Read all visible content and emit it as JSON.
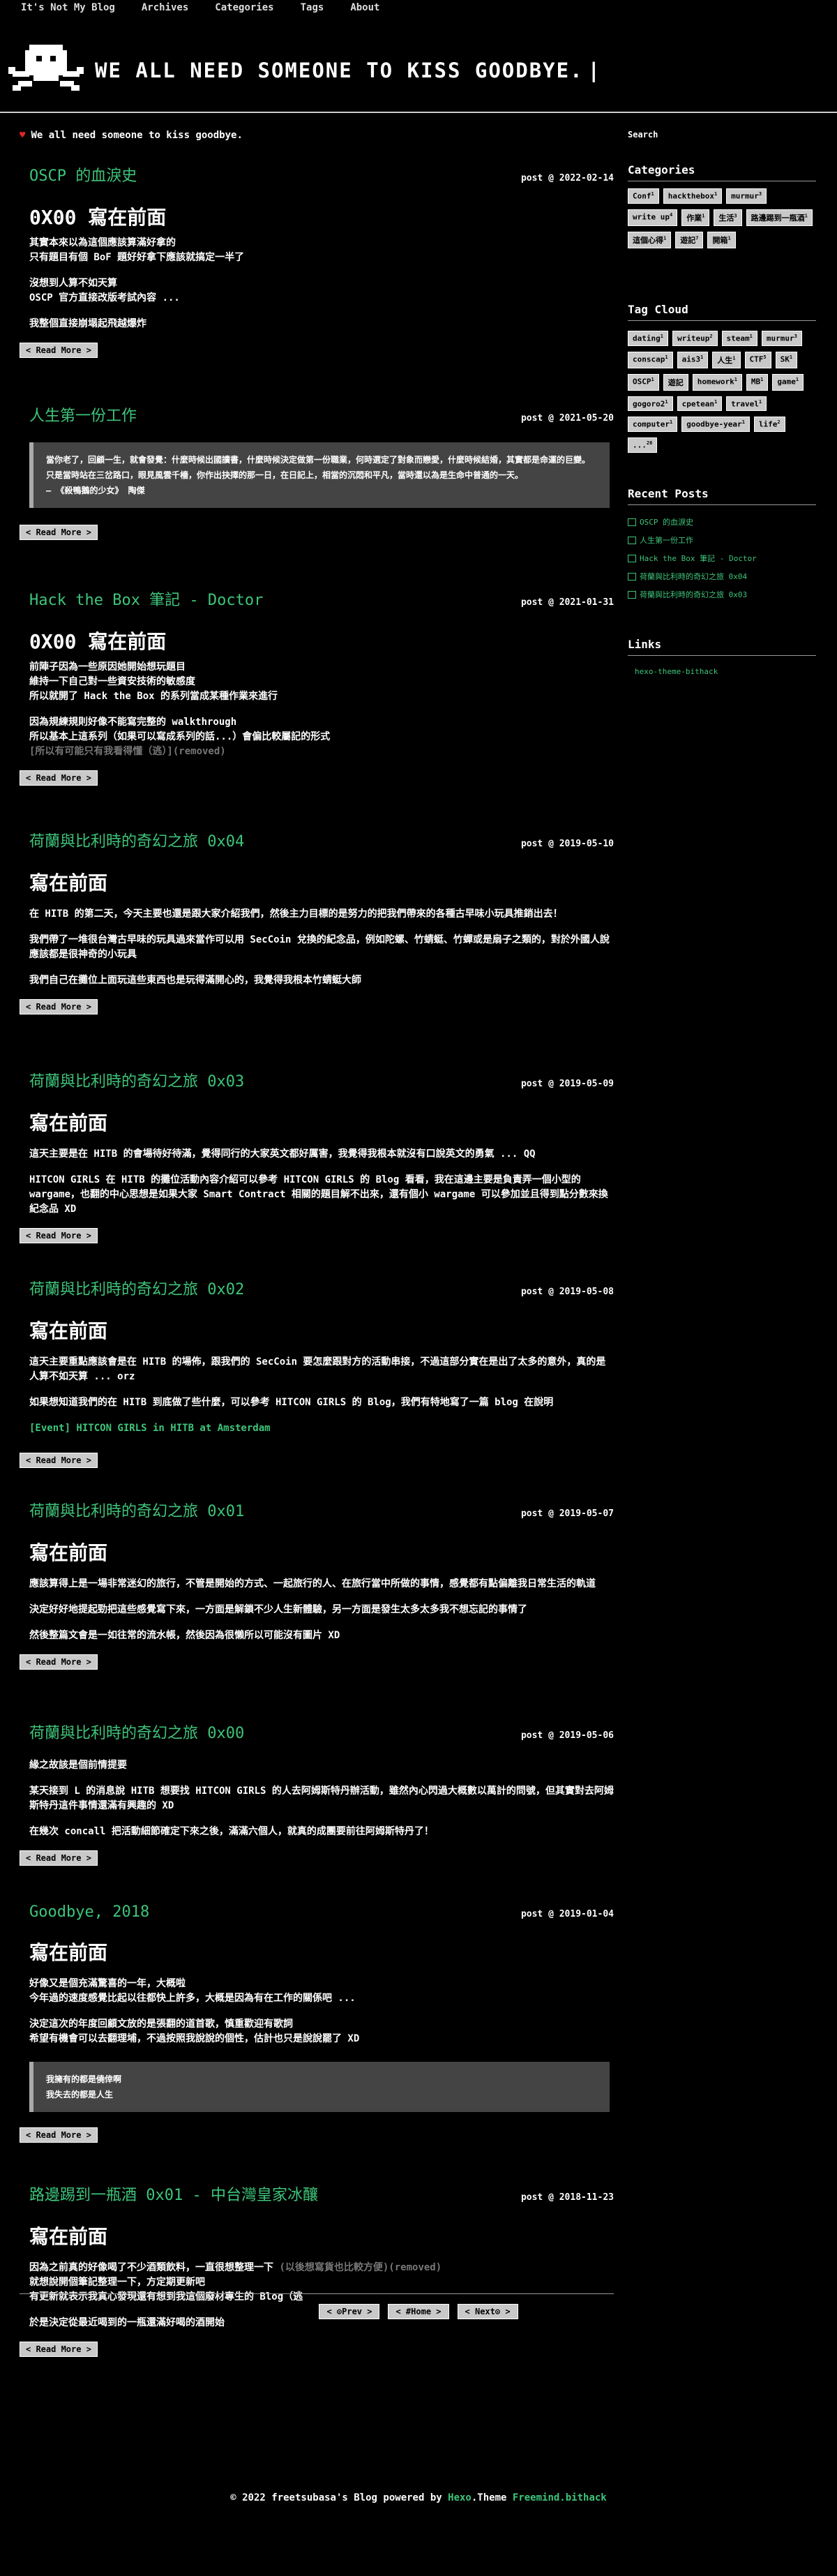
{
  "nav": {
    "items": [
      "It's Not My Blog",
      "Archives",
      "Categories",
      "Tags",
      "About"
    ]
  },
  "banner": {
    "title": "WE ALL NEED SOMEONE TO KISS GOODBYE.",
    "caret": "|"
  },
  "welcome": "We all need someone to kiss goodbye.",
  "read_more": "< Read More >",
  "posts": [
    {
      "title": "OSCP 的血淚史",
      "date": "post @ 2022-02-14",
      "heading": "0X00 寫在前面",
      "lines": [
        "其實本來以為這個應該算滿好拿的",
        "只有題目有個 BoF 題好好拿下應該就搞定一半了",
        "",
        "沒想到人算不如天算",
        "OSCP 官方直接改版考試內容 ...",
        "",
        "我整個直接崩塌起飛越爆炸"
      ]
    },
    {
      "title": "人生第一份工作",
      "date": "post @ 2021-05-20",
      "quote": [
        "當你老了，回顧一生，就會發覺：什麼時候出國讀書，什麼時候決定做第一份職業，何時選定了對象而戀愛，什麼時候結婚，其實都是命運的巨變。只是當時站在三岔路口，眼見風雲千檣，你作出抉擇的那一日，在日記上，相當的沉悶和平凡，當時還以為是生命中普通的一天。",
        "— 《殺鴨鵝的少女》 陶傑"
      ]
    },
    {
      "title": "Hack the Box 筆記 - Doctor",
      "date": "post @ 2021-01-31",
      "heading": "0X00 寫在前面",
      "lines": [
        "前陣子因為一些原因她開始想玩題目",
        "維持一下自己對一些資安技術的敏感度",
        "所以就開了 Hack the Box 的系列當成某種作業來進行",
        "",
        "因為規練規則好像不能寫完整的 walkthrough",
        "所以基本上這系列（如果可以寫成系列的話...）會偏比較屬記的形式"
      ],
      "removed": "[所以有可能只有我看得懂（逃）](removed)"
    },
    {
      "title": "荷蘭與比利時的奇幻之旅 0x04",
      "date": "post @ 2019-05-10",
      "heading": "寫在前面",
      "lines": [
        "在 HITB 的第二天，今天主要也還是跟大家介紹我們，然後主力目標的是努力的把我們帶來的各種古早味小玩具推銷出去！",
        "",
        "我們帶了一堆很台灣古早味的玩具過來當作可以用 SecCoin 兌換的紀念品，例如陀螺、竹蜻蜓、竹蟬或是扇子之類的，對於外國人說應該都是很神奇的小玩具",
        "",
        "我們自己在攤位上面玩這些東西也是玩得滿開心的，我覺得我根本竹蜻蜓大師"
      ]
    },
    {
      "title": "荷蘭與比利時的奇幻之旅 0x03",
      "date": "post @ 2019-05-09",
      "heading": "寫在前面",
      "lines": [
        "這天主要是在 HITB 的會場待好待滿，覺得同行的大家英文都好厲害，我覺得我根本就沒有口說英文的勇氣 ... QQ",
        "",
        "HITCON GIRLS 在 HITB 的攤位活動內容介紹可以參考 HITCON GIRLS 的 Blog 看看，我在這邊主要是負責弄一個小型的 wargame，也翻的中心思想是如果大家 Smart Contract 相關的題目解不出來，還有個小 wargame 可以參加並且得到點分數來換紀念品 XD"
      ]
    },
    {
      "title": "荷蘭與比利時的奇幻之旅 0x02",
      "date": "post @ 2019-05-08",
      "heading": "寫在前面",
      "lines": [
        "這天主要重點應該會是在 HITB 的場佈，跟我們的 SecCoin 要怎麼跟對方的活動串接，不過這部分實在是出了太多的意外，真的是人算不如天算 ... orz",
        "",
        "如果想知道我們的在 HITB 到底做了些什麼，可以參考 HITCON GIRLS 的 Blog，我們有特地寫了一篇 blog 在說明"
      ],
      "link": "[Event] HITCON GIRLS in HITB at Amsterdam"
    },
    {
      "title": "荷蘭與比利時的奇幻之旅 0x01",
      "date": "post @ 2019-05-07",
      "heading": "寫在前面",
      "lines": [
        "應該算得上是一場非常迷幻的旅行，不管是開始的方式、一起旅行的人、在旅行當中所做的事情，感覺都有點偏離我日常生活的軌道",
        "",
        "決定好好地提起勁把這些感覺寫下來，一方面是解鎖不少人生新體驗，另一方面是發生太多太多我不想忘記的事情了",
        "",
        "然後整篇文會是一如往常的流水帳，然後因為很懶所以可能沒有圖片 XD"
      ]
    },
    {
      "title": "荷蘭與比利時的奇幻之旅 0x00",
      "date": "post @ 2019-05-06",
      "lines": [
        "緣之故該是個前情提要",
        "",
        "某天接到 L 的消息說 HITB 想要找 HITCON GIRLS 的人去阿姆斯特丹辦活動，雖然內心閃過大概數以萬計的問號，但其實對去阿姆斯特丹這件事情還滿有興趣的 XD",
        "",
        "在幾次 concall 把活動細節確定下來之後，滿滿六個人，就真的成團要前往阿姆斯特丹了！"
      ]
    },
    {
      "title": "Goodbye, 2018",
      "date": "post @ 2019-01-04",
      "heading": "寫在前面",
      "lines": [
        "好像又是個充滿驚喜的一年，大概啦",
        "今年過的速度感覺比起以往都快上許多，大概是因為有在工作的關係吧 ...",
        "",
        "決定這次的年度回顧文放的是張翻的道首歌，慎重歡迎有歌詞",
        "希望有機會可以去翻理埔，不過按照我說說的個性，估計也只是說說罷了 XD"
      ],
      "quote": [
        "我擁有的都是僥倖啊",
        "我失去的都是人生"
      ]
    },
    {
      "title": "路邊踢到一瓶酒 0x01 - 中台灣皇家冰釀",
      "date": "post @ 2018-11-23",
      "heading": "寫在前面",
      "lines_pre": "因為之前真的好像喝了不少酒類飲料，一直很想整理一下",
      "removed": "(以後想寫貨也比較方便)(removed)",
      "lines": [
        "就想說開個筆記整理一下，方定期更新吧",
        "有更新就表示我真心發現還有想到我這個廢材專生的 Blog（逃",
        "",
        "於是決定從最近喝到的一瓶還滿好喝的酒開始"
      ]
    }
  ],
  "sidebar": {
    "search_label": "Search",
    "categories_title": "Categories",
    "categories": [
      {
        "name": "Conf",
        "count": "1"
      },
      {
        "name": "hackthebox",
        "count": "1"
      },
      {
        "name": "murmur",
        "count": "3"
      },
      {
        "name": "write up",
        "count": "4"
      },
      {
        "name": "作業",
        "count": "1"
      },
      {
        "name": "生活",
        "count": "3"
      },
      {
        "name": "路邊踢到一瓶酒",
        "count": "1"
      },
      {
        "name": "這個心得",
        "count": "1"
      },
      {
        "name": "遊記",
        "count": "7"
      },
      {
        "name": "開箱",
        "count": "1"
      }
    ],
    "tagcloud_title": "Tag Cloud",
    "tags": [
      {
        "name": "dating",
        "count": "1"
      },
      {
        "name": "writeup",
        "count": "2"
      },
      {
        "name": "steam",
        "count": "1"
      },
      {
        "name": "murmur",
        "count": "3"
      },
      {
        "name": "conscap",
        "count": "1"
      },
      {
        "name": "ais3",
        "count": "1"
      },
      {
        "name": "人生",
        "count": "1"
      },
      {
        "name": "CTF",
        "count": "5"
      },
      {
        "name": "SK",
        "count": "1"
      },
      {
        "name": "OSCP",
        "count": "1"
      },
      {
        "name": "遊記",
        "count": ""
      },
      {
        "name": "homework",
        "count": "1"
      },
      {
        "name": "MB",
        "count": "1"
      },
      {
        "name": "game",
        "count": "1"
      },
      {
        "name": "gogoro2",
        "count": "1"
      },
      {
        "name": "cpetean",
        "count": "1"
      },
      {
        "name": "travel",
        "count": "1"
      },
      {
        "name": "computer",
        "count": "1"
      },
      {
        "name": "goodbye-year",
        "count": "1"
      },
      {
        "name": "life",
        "count": "2"
      },
      {
        "name": "...",
        "count": "26"
      }
    ],
    "recent_title": "Recent Posts",
    "recent": [
      "OSCP 的血淚史",
      "人生第一份工作",
      "Hack the Box 筆記 - Doctor",
      "荷蘭與比利時的奇幻之旅 0x04",
      "荷蘭與比利時的奇幻之旅 0x03"
    ],
    "links_title": "Links",
    "links": [
      "hexo-theme-bithack"
    ]
  },
  "pager": {
    "prev": "< ⊙Prev >",
    "home": "< #Home >",
    "next": "< Next⊙ >"
  },
  "footer": {
    "prefix": "© 2022 freetsubasa's Blog powered by ",
    "hexo": "Hexo",
    "theme_word": ".Theme ",
    "theme": "Freemind.bithack"
  }
}
